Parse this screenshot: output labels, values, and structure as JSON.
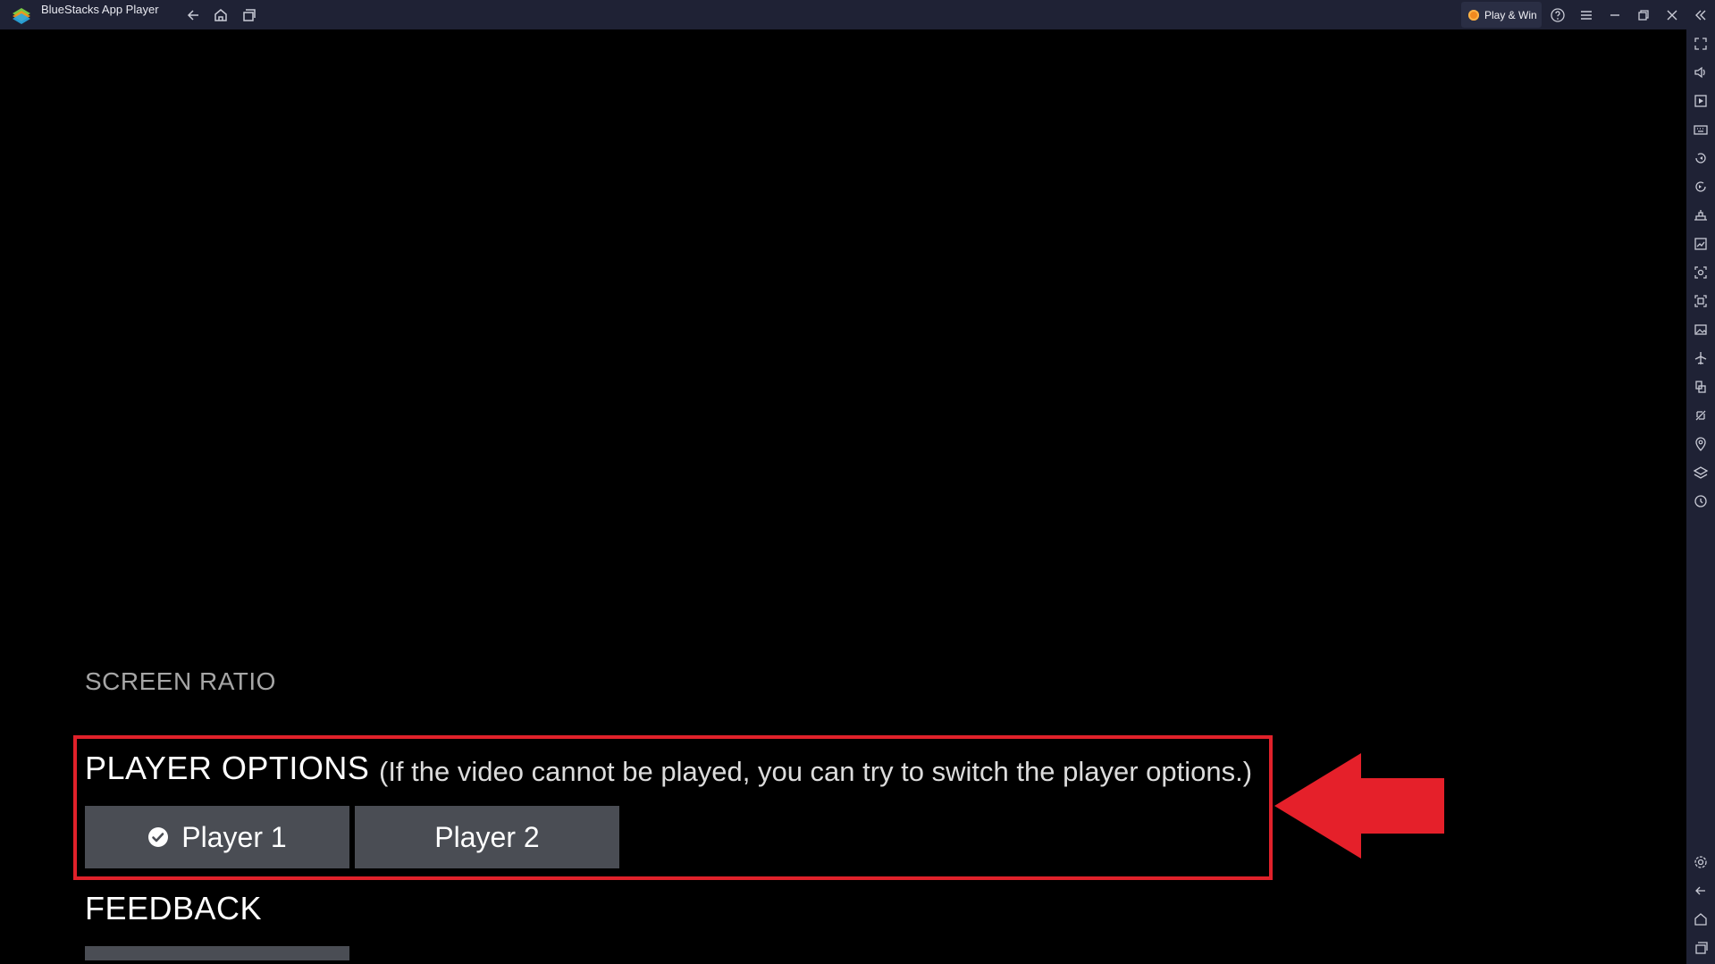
{
  "window": {
    "title": "BlueStacks App Player",
    "play_win_label": "Play & Win"
  },
  "titlebar_icons": {
    "nav": [
      "back-arrow-icon",
      "home-icon",
      "recent-apps-icon"
    ],
    "right": [
      "help-icon",
      "menu-icon",
      "minimize-icon",
      "restore-icon",
      "close-icon",
      "collapse-sidebar-icon"
    ]
  },
  "sidebar_icons": [
    "fullscreen-icon",
    "volume-icon",
    "media-manager-icon",
    "keyboard-icon",
    "rotate-left-icon",
    "rotate-right-icon",
    "macro-icon",
    "performance-icon",
    "screenshot-icon",
    "record-icon",
    "gallery-icon",
    "airplane-icon",
    "multi-instance-icon",
    "eco-mode-icon",
    "location-icon",
    "layers-icon",
    "sync-icon",
    "settings-icon",
    "back-icon",
    "home-icon",
    "recent-icon"
  ],
  "settings": {
    "screen_ratio_label": "SCREEN RATIO",
    "player_options_label": "PLAYER OPTIONS",
    "player_options_hint": "(If the video cannot be played, you can try to switch the player options.)",
    "players": [
      {
        "label": "Player 1",
        "selected": true
      },
      {
        "label": "Player 2",
        "selected": false
      }
    ],
    "feedback_label": "FEEDBACK"
  },
  "colors": {
    "highlight": "#e0212a",
    "button_bg": "#4a4d54",
    "chrome_bg": "#1f2235"
  }
}
